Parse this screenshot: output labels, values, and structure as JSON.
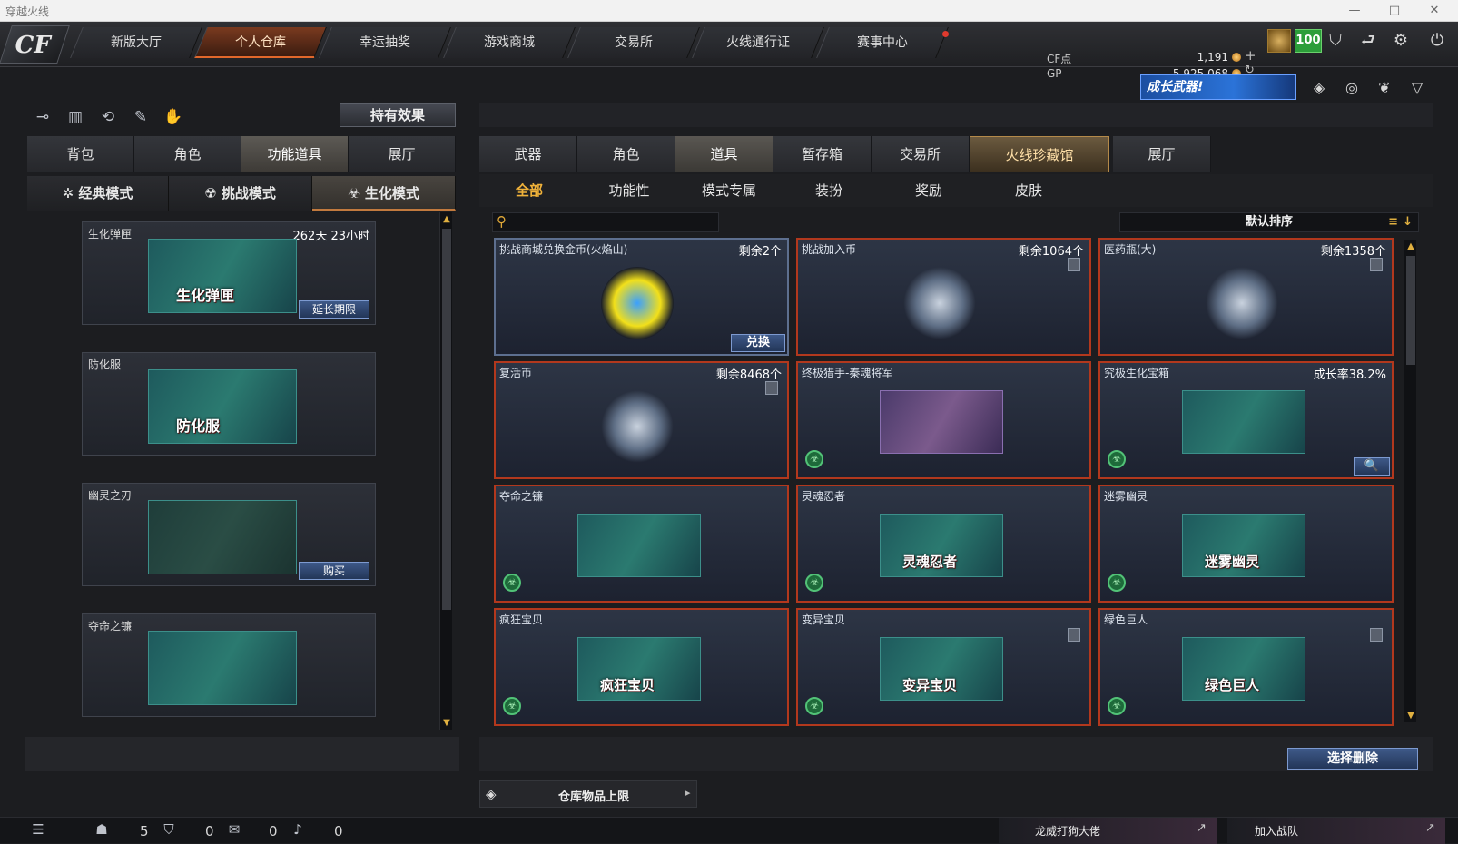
{
  "window": {
    "title": "穿越火线",
    "controls": [
      "—",
      "□",
      "✕"
    ]
  },
  "nav": {
    "logo": "CF",
    "tabs": [
      {
        "label": "新版大厅",
        "active": false
      },
      {
        "label": "个人仓库",
        "active": true
      },
      {
        "label": "幸运抽奖",
        "active": false
      },
      {
        "label": "游戏商城",
        "active": false
      },
      {
        "label": "交易所",
        "active": false
      },
      {
        "label": "火线通行证",
        "active": false
      },
      {
        "label": "赛事中心",
        "active": false
      }
    ]
  },
  "currency": {
    "cf_label": "CF点",
    "cf_value": "1,191",
    "gp_label": "GP",
    "gp_value": "5,925,068"
  },
  "player": {
    "level": "100"
  },
  "banner": {
    "text": "成长武器!"
  },
  "left": {
    "hold_effect_btn": "持有效果",
    "category_tabs": [
      {
        "label": "背包",
        "active": false
      },
      {
        "label": "角色",
        "active": false
      },
      {
        "label": "功能道具",
        "active": true
      },
      {
        "label": "展厅",
        "active": false
      }
    ],
    "mode_tabs": [
      {
        "label": "经典模式",
        "icon": "✲",
        "active": false
      },
      {
        "label": "挑战模式",
        "icon": "☢",
        "active": false
      },
      {
        "label": "生化模式",
        "icon": "☣",
        "active": true
      }
    ],
    "items": [
      {
        "name": "生化弹匣",
        "time": "262天 23小时",
        "img_label": "生化弹匣",
        "button": "延长期限"
      },
      {
        "name": "防化服",
        "time": "",
        "img_label": "防化服",
        "button": ""
      },
      {
        "name": "幽灵之刃",
        "time": "",
        "img_label": "",
        "button": "购买"
      },
      {
        "name": "夺命之镰",
        "time": "",
        "img_label": "",
        "button": ""
      }
    ]
  },
  "right": {
    "main_tabs": [
      {
        "label": "武器",
        "state": "normal"
      },
      {
        "label": "角色",
        "state": "normal"
      },
      {
        "label": "道具",
        "state": "active"
      },
      {
        "label": "暂存箱",
        "state": "normal"
      },
      {
        "label": "交易所",
        "state": "normal"
      },
      {
        "label": "火线珍藏馆",
        "state": "special"
      },
      {
        "label": "展厅",
        "state": "normal"
      }
    ],
    "sub_tabs": [
      {
        "label": "全部",
        "active": true
      },
      {
        "label": "功能性",
        "active": false
      },
      {
        "label": "模式专属",
        "active": false
      },
      {
        "label": "装扮",
        "active": false
      },
      {
        "label": "奖励",
        "active": false
      },
      {
        "label": "皮肤",
        "active": false
      }
    ],
    "search": {
      "placeholder": ""
    },
    "sort_label": "默认排序",
    "cards": [
      {
        "name": "挑战商城兑换金币(火焰山)",
        "count": "剩余2个",
        "img_label": "",
        "button": "兑换",
        "style": "blue",
        "badge": false,
        "trash": false
      },
      {
        "name": "挑战加入币",
        "count": "剩余1064个",
        "img_label": "",
        "button": "",
        "style": "red",
        "badge": false,
        "trash": true
      },
      {
        "name": "医药瓶(大)",
        "count": "剩余1358个",
        "img_label": "",
        "button": "",
        "style": "red",
        "badge": false,
        "trash": true
      },
      {
        "name": "复活币",
        "count": "剩余8468个",
        "img_label": "",
        "button": "",
        "style": "red",
        "badge": false,
        "trash": true
      },
      {
        "name": "终极猎手-秦魂将军",
        "count": "",
        "img_label": "",
        "button": "",
        "style": "red",
        "badge": true,
        "trash": false
      },
      {
        "name": "究极生化宝箱",
        "count": "成长率38.2%",
        "img_label": "",
        "button": "🔍",
        "style": "red",
        "badge": true,
        "trash": false
      },
      {
        "name": "夺命之镰",
        "count": "",
        "img_label": "",
        "button": "",
        "style": "red",
        "badge": true,
        "trash": false
      },
      {
        "name": "灵魂忍者",
        "count": "",
        "img_label": "灵魂忍者",
        "button": "",
        "style": "red",
        "badge": true,
        "trash": false
      },
      {
        "name": "迷雾幽灵",
        "count": "",
        "img_label": "迷雾幽灵",
        "button": "",
        "style": "red",
        "badge": true,
        "trash": false
      },
      {
        "name": "疯狂宝贝",
        "count": "",
        "img_label": "疯狂宝贝",
        "button": "",
        "style": "red",
        "badge": true,
        "trash": false
      },
      {
        "name": "变异宝贝",
        "count": "",
        "img_label": "变异宝贝",
        "button": "",
        "style": "red",
        "badge": true,
        "trash": true
      },
      {
        "name": "绿色巨人",
        "count": "",
        "img_label": "绿色巨人",
        "button": "",
        "style": "red",
        "badge": true,
        "trash": true
      }
    ],
    "select_delete_btn": "选择删除",
    "storage_limit": "仓库物品上限"
  },
  "bottom": {
    "stats": [
      "5",
      "0",
      "0",
      "0"
    ],
    "clan_name": "龙威打狗大佬",
    "join_team": "加入战队"
  },
  "colors": {
    "accent_orange": "#f0b23a",
    "card_border_red": "#b2381d",
    "level_green": "#2c9e3a"
  }
}
